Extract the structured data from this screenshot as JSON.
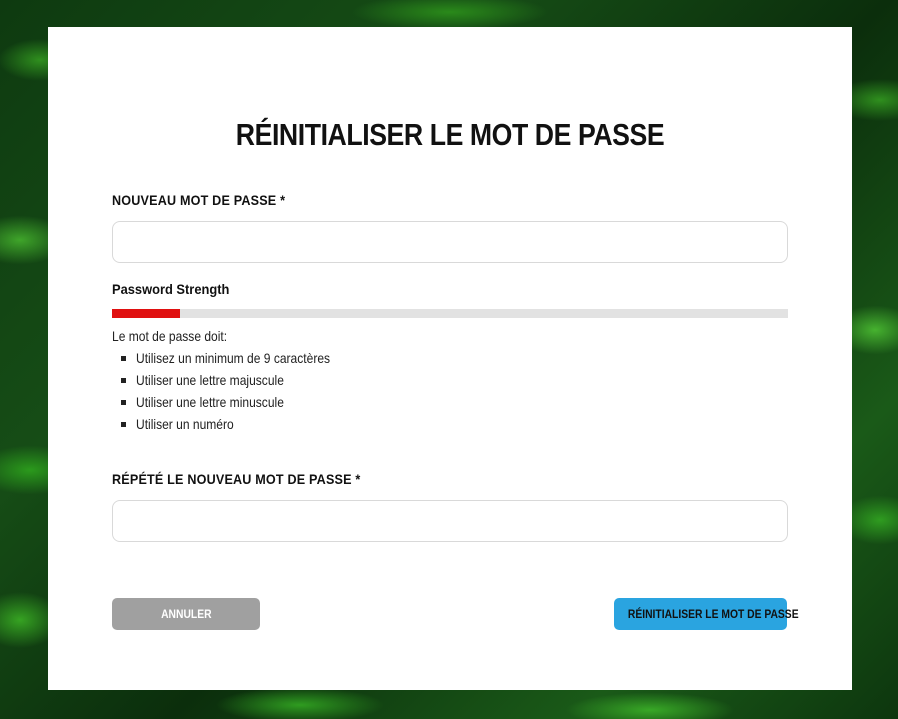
{
  "form": {
    "title": "RÉINITIALISER LE MOT DE PASSE",
    "new_password": {
      "label": "NOUVEAU MOT DE PASSE *",
      "value": "",
      "placeholder": ""
    },
    "strength": {
      "label": "Password Strength",
      "level_fraction": 0.1,
      "color": "#e01010",
      "track_color": "#e2e2e2"
    },
    "rules": {
      "intro": "Le mot de passe doit:",
      "items": [
        "Utilisez un minimum de 9 caractères",
        "Utiliser une lettre majuscule",
        "Utiliser une lettre minuscule",
        "Utiliser un numéro"
      ]
    },
    "repeat_password": {
      "label": "RÉPÉTÉ LE NOUVEAU MOT DE PASSE *",
      "value": "",
      "placeholder": ""
    },
    "buttons": {
      "cancel_label": "ANNULER",
      "submit_label": "RÉINITIALISER LE MOT DE PASSE",
      "cancel_color": "#a0a0a0",
      "submit_color": "#2aa4e0"
    }
  }
}
